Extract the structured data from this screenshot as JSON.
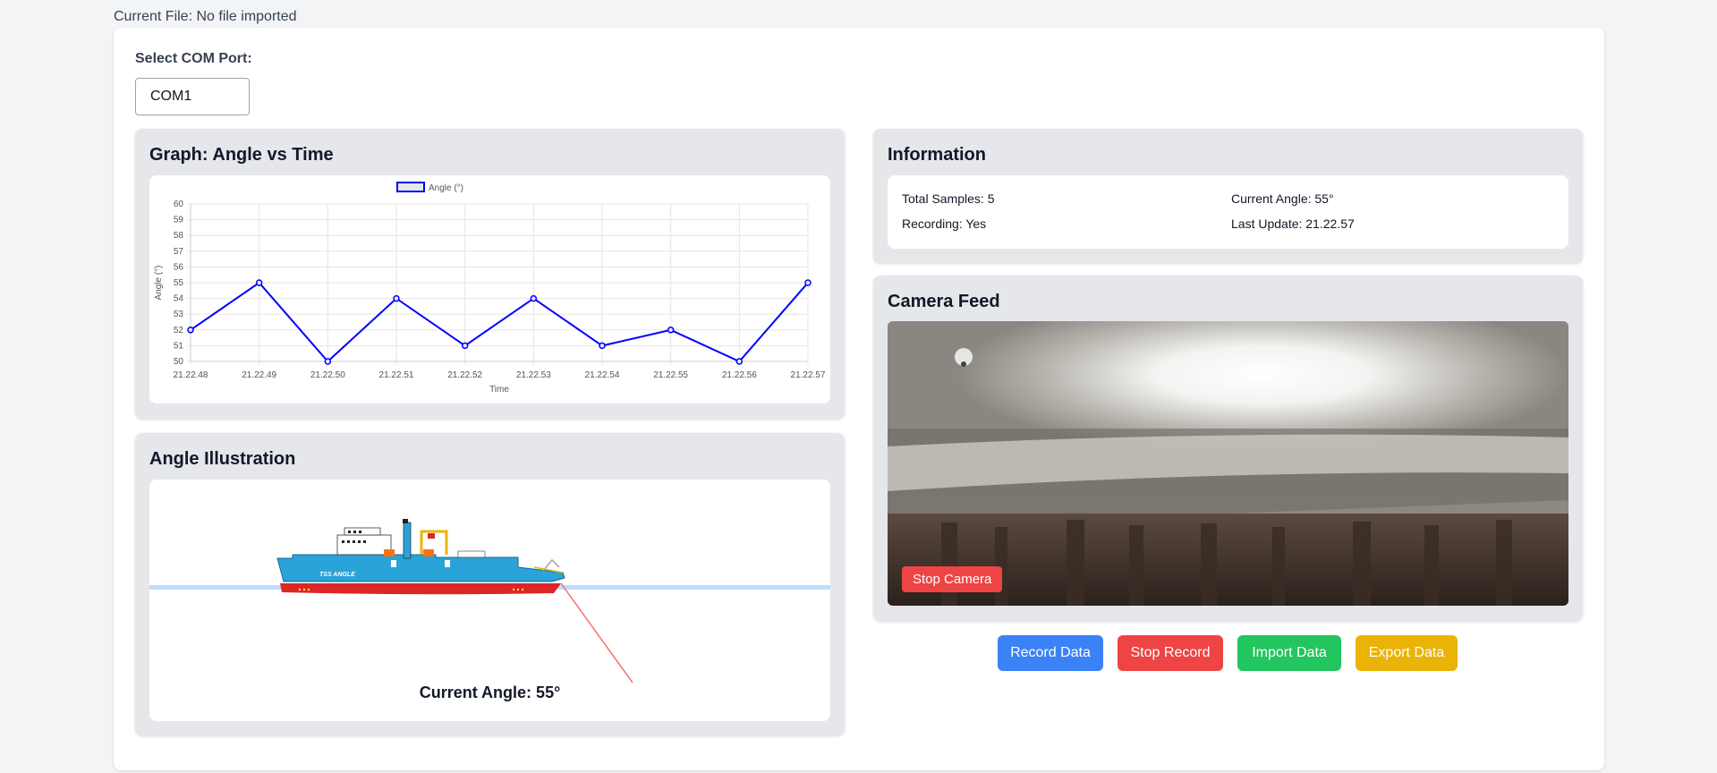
{
  "header": {
    "current_file": "Current File: No file imported"
  },
  "com_port": {
    "label": "Select COM Port:",
    "selected": "COM1"
  },
  "graph": {
    "title": "Graph: Angle vs Time",
    "chart_data": {
      "type": "line",
      "legend": "Angle (°)",
      "xlabel": "Time",
      "ylabel": "Angle (°)",
      "ylim": [
        50,
        60
      ],
      "yticks": [
        50,
        51,
        52,
        53,
        54,
        55,
        56,
        57,
        58,
        59,
        60
      ],
      "categories": [
        "21.22.48",
        "21.22.49",
        "21.22.50",
        "21.22.51",
        "21.22.52",
        "21.22.53",
        "21.22.54",
        "21.22.55",
        "21.22.56",
        "21.22.57"
      ],
      "series": [
        {
          "name": "Angle (°)",
          "values": [
            52,
            55,
            50,
            54,
            51,
            54,
            51,
            52,
            50,
            55
          ],
          "color": "#0000ff"
        }
      ]
    }
  },
  "illustration": {
    "title": "Angle Illustration",
    "ship_name": "TSS ANGLE",
    "current_angle": "Current Angle: 55°"
  },
  "info": {
    "title": "Information",
    "total_samples": "Total Samples: 5",
    "current_angle": "Current Angle: 55°",
    "recording": "Recording: Yes",
    "last_update": "Last Update: 21.22.57"
  },
  "camera": {
    "title": "Camera Feed",
    "stop_label": "Stop Camera"
  },
  "actions": {
    "record": "Record Data",
    "stop": "Stop Record",
    "import": "Import Data",
    "export": "Export Data"
  },
  "colors": {
    "blue": "#3b82f6",
    "red": "#ef4444",
    "green": "#22c55e",
    "yellow": "#eab308"
  }
}
